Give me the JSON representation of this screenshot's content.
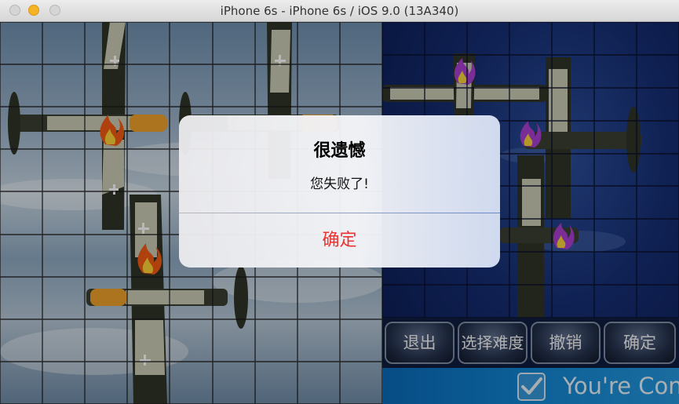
{
  "window": {
    "title": "iPhone 6s - iPhone 6s / iOS 9.0 (13A340)"
  },
  "alert": {
    "title": "很遗憾",
    "message": "您失败了!",
    "confirm_label": "确定"
  },
  "game_buttons": {
    "exit": "退出",
    "difficulty": "选择难度",
    "undo": "撤销",
    "confirm": "确定"
  },
  "banner": {
    "text": "You're Con"
  },
  "boards": {
    "player_grid": {
      "rows": 9,
      "cols": 9
    },
    "enemy_grid": {
      "rows": 9,
      "cols": 7
    }
  },
  "colors": {
    "alert_button": "#ee3130",
    "plane_body": "#2f3428",
    "plane_light": "#c9cbb5",
    "nose": "#f0a12b"
  },
  "icons": {
    "fire": "fire-icon",
    "purple_fire": "purple-fire-icon",
    "check": "check-icon"
  }
}
